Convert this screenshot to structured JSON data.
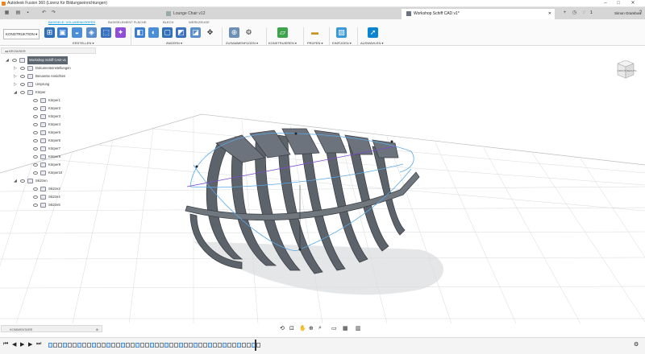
{
  "window": {
    "title": "Autodesk Fusion 360 (Lizenz für Bildungseinrichtungen)",
    "controls": [
      "–",
      "□",
      "✕"
    ]
  },
  "tabs": [
    {
      "label": "Lounge Chair v12",
      "active": false
    },
    {
      "label": "Workshop Schiff CAD v1*",
      "active": true
    }
  ],
  "account": {
    "user": "Simon Grambow",
    "notifications": "1",
    "tab_count": "1"
  },
  "ribbon": {
    "workspace": "KONSTRUKTION",
    "tabs": [
      "BASISELE. VOLUMENKÖRPER",
      "BASISELEMENT FLÄCHE",
      "BLECH",
      "WERKZEUGE"
    ],
    "active_tab": "BASISELE. VOLUMENKÖRPER",
    "groups": [
      "ERSTELLEN ▾",
      "ÄNDERN ▾",
      "ZUSAMMENFÜGEN ▾",
      "KONSTRUIEREN ▾",
      "PRÜFEN ▾",
      "EINFÜGEN ▾",
      "AUSWÄHLEN ▾"
    ]
  },
  "browser": {
    "title": "BROWSER",
    "root": "Workshop Schiff CAD v1",
    "items": [
      {
        "label": "Dokumenteinstellungen",
        "level": 1
      },
      {
        "label": "Benannte Ansichten",
        "level": 1
      },
      {
        "label": "Ursprung",
        "level": 1
      },
      {
        "label": "Körper",
        "level": 1
      },
      {
        "label": "Körper1",
        "level": 2
      },
      {
        "label": "Körper2",
        "level": 2
      },
      {
        "label": "Körper3",
        "level": 2
      },
      {
        "label": "Körper4",
        "level": 2
      },
      {
        "label": "Körper5",
        "level": 2
      },
      {
        "label": "Körper6",
        "level": 2
      },
      {
        "label": "Körper7",
        "level": 2
      },
      {
        "label": "Körper8",
        "level": 2
      },
      {
        "label": "Körper9",
        "level": 2
      },
      {
        "label": "Körper10",
        "level": 2
      },
      {
        "label": "Skizzen",
        "level": 1
      },
      {
        "label": "Skizze2",
        "level": 2
      },
      {
        "label": "Skizze4",
        "level": 2
      },
      {
        "label": "Skizze5",
        "level": 2
      }
    ]
  },
  "viewcube": {
    "front": "FRONT",
    "right": "RECHTS"
  },
  "comments": {
    "label": "KOMMENTARE"
  },
  "colors": {
    "accent": "#0696d7",
    "model": "#59606a",
    "selection": "#5aa9e6"
  }
}
